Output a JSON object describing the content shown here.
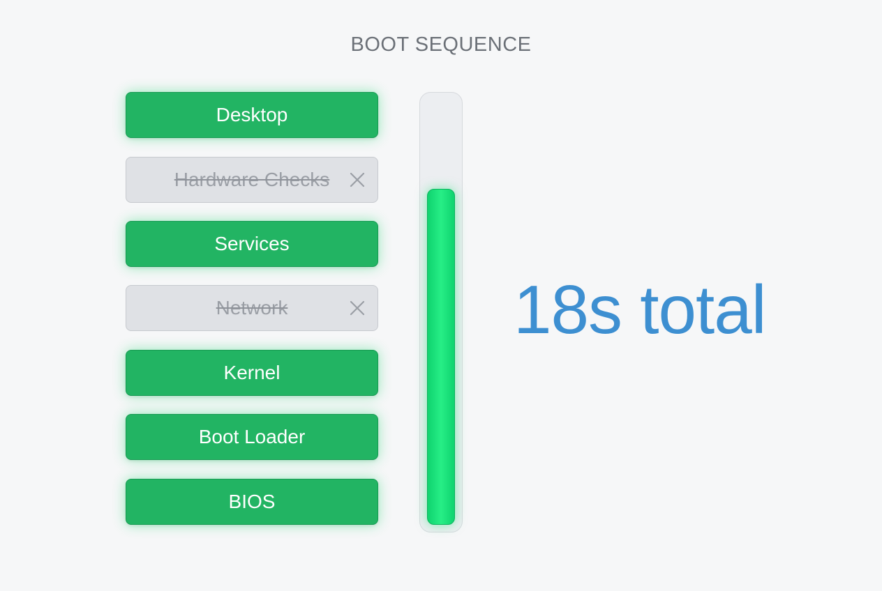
{
  "header": {
    "title": "BOOT SEQUENCE"
  },
  "stages": [
    {
      "label": "Desktop",
      "state": "active"
    },
    {
      "label": "Hardware Checks",
      "state": "skipped",
      "icon": "close-icon"
    },
    {
      "label": "Services",
      "state": "active"
    },
    {
      "label": "Network",
      "state": "skipped",
      "icon": "close-icon"
    },
    {
      "label": "Kernel",
      "state": "active"
    },
    {
      "label": "Boot Loader",
      "state": "active"
    },
    {
      "label": "BIOS",
      "state": "active"
    }
  ],
  "progress": {
    "fraction": 0.79
  },
  "summary": {
    "total_text": "18s total"
  },
  "colors": {
    "active": "#22b463",
    "skipped": "#dfe1e5",
    "progress_fill": "#1ee47c",
    "total_text": "#3d8fd1"
  }
}
